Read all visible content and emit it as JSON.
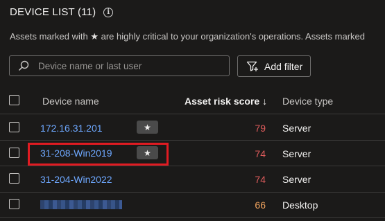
{
  "header": {
    "title": "DEVICE LIST (11)",
    "info_icon": "info-icon",
    "subtitle_prefix": "Assets marked with",
    "subtitle_suffix": "are highly critical to your organization's operations. Assets marked"
  },
  "search": {
    "placeholder": "Device name or last user",
    "value": "",
    "icon": "search-icon"
  },
  "toolbar": {
    "add_filter_label": "Add filter",
    "filter_icon": "filter-add-icon"
  },
  "table": {
    "columns": [
      "Device name",
      "Asset risk score",
      "Device type"
    ],
    "sort_indicator": "↓",
    "rows": [
      {
        "name": "172.16.31.201",
        "critical": true,
        "score": "79",
        "score_color": "#e05c5c",
        "type": "Server"
      },
      {
        "name": "31-208-Win2019",
        "critical": true,
        "score": "74",
        "score_color": "#e05c5c",
        "type": "Server",
        "highlighted": true
      },
      {
        "name": "31-204-Win2022",
        "critical": false,
        "score": "74",
        "score_color": "#e05c5c",
        "type": "Server"
      },
      {
        "name": "",
        "critical": false,
        "score": "66",
        "score_color": "#f0a35e",
        "type": "Desktop",
        "name_obscured": true
      }
    ]
  },
  "colors": {
    "link": "#6ea8ff",
    "highlight_border": "#e11b22",
    "background": "#1b1a19"
  }
}
